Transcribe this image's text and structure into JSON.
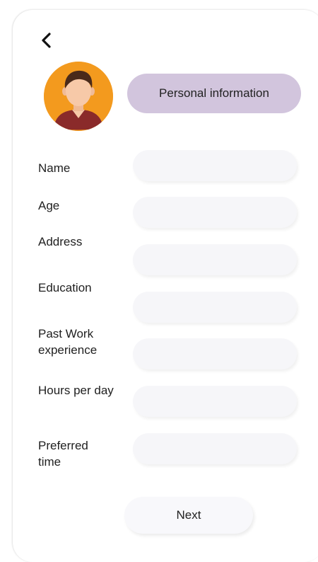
{
  "header": {
    "back_icon": "chevron-left-icon",
    "title": "Personal information"
  },
  "avatar": {
    "icon": "user-avatar-icon",
    "bg_color": "#f39a1e",
    "shirt_color": "#8a2a2a",
    "skin_color": "#f7c9a8",
    "hair_color": "#4a2a1a"
  },
  "form": {
    "fields": [
      {
        "label": "Name",
        "value": ""
      },
      {
        "label": "Age",
        "value": ""
      },
      {
        "label": "Address",
        "value": ""
      },
      {
        "label": "Education",
        "value": ""
      },
      {
        "label": "Past Work experience",
        "value": ""
      },
      {
        "label": "Hours per day",
        "value": ""
      },
      {
        "label": "Preferred time",
        "value": ""
      }
    ]
  },
  "footer": {
    "next_label": "Next"
  },
  "colors": {
    "title_pill": "#d2c5dd",
    "field_bg": "#f6f6f9"
  }
}
